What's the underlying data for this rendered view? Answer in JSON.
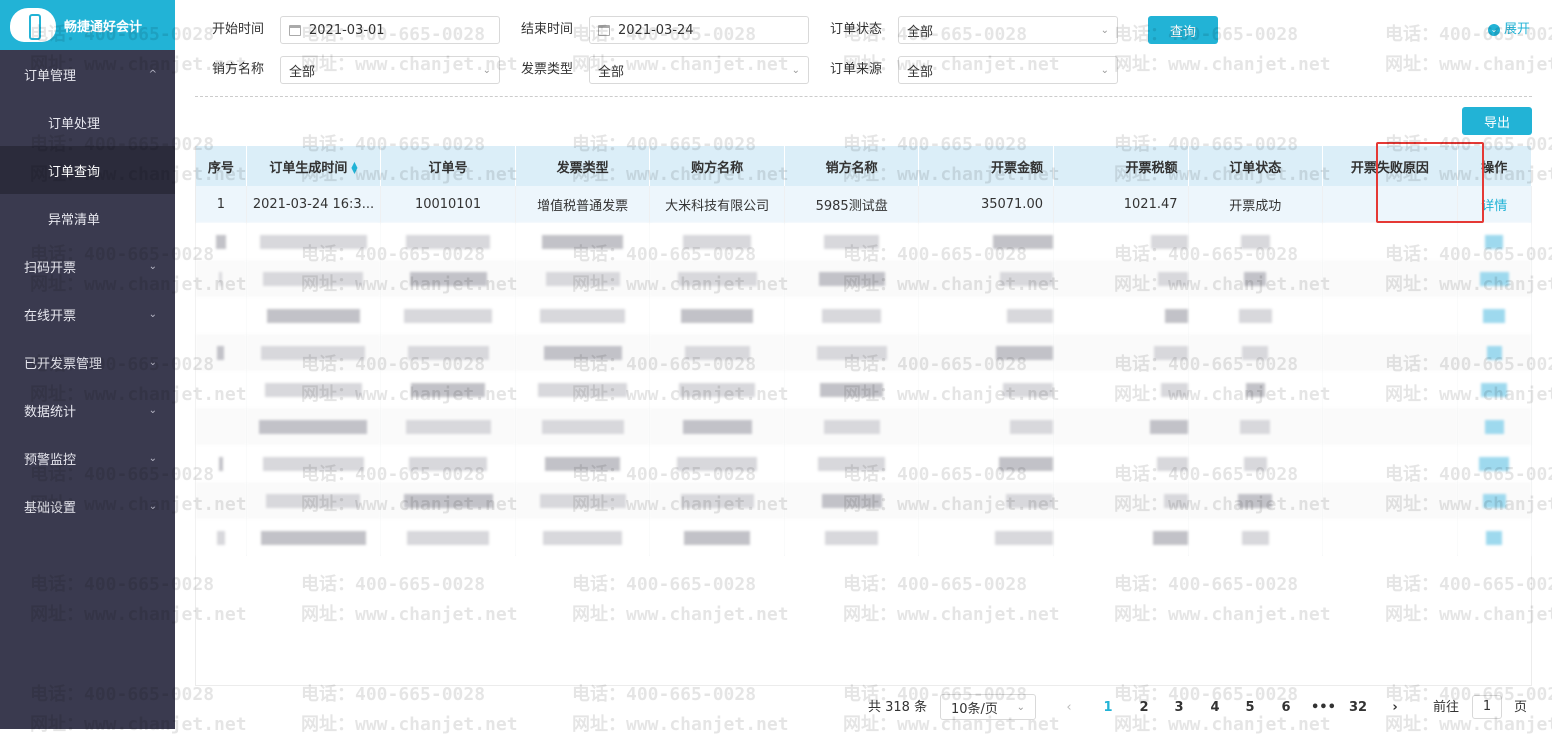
{
  "app": {
    "name": "畅捷通好会计"
  },
  "sidebar": {
    "groups": [
      {
        "label": "订单管理",
        "chevron": "^",
        "children": [
          "订单处理",
          "订单查询",
          "异常清单"
        ]
      },
      {
        "label": "扫码开票",
        "chevron": "⌄"
      },
      {
        "label": "在线开票",
        "chevron": "⌄"
      },
      {
        "label": "已开发票管理",
        "chevron": "⌄"
      },
      {
        "label": "数据统计",
        "chevron": "⌄"
      },
      {
        "label": "预警监控",
        "chevron": "⌄"
      },
      {
        "label": "基础设置",
        "chevron": "⌄"
      }
    ]
  },
  "filters": {
    "start_label": "开始时间",
    "start_value": "2021-03-01",
    "end_label": "结束时间",
    "end_value": "2021-03-24",
    "status_label": "订单状态",
    "status_value": "全部",
    "seller_label": "销方名称",
    "seller_value": "全部",
    "invoice_type_label": "发票类型",
    "invoice_type_value": "全部",
    "source_label": "订单来源",
    "source_value": "全部",
    "query_button": "查询",
    "expand_label": "展开",
    "export_button": "导出"
  },
  "table": {
    "headers": [
      "序号",
      "订单生成时间",
      "订单号",
      "发票类型",
      "购方名称",
      "销方名称",
      "开票金额",
      "开票税额",
      "订单状态",
      "开票失败原因",
      "操作"
    ],
    "row": [
      "1",
      "2021-03-24 16:3...",
      "10010101",
      "增值税普通发票",
      "大米科技有限公司",
      "5985测试盘",
      "35071.00",
      "1021.47",
      "开票成功",
      "",
      "详情"
    ]
  },
  "watermark": {
    "phone": "电话：400-665-0028",
    "site": "网址：www.chanjet.net"
  },
  "pagination": {
    "total": "共 318 条",
    "page_size": "10条/页",
    "pages": [
      "1",
      "2",
      "3",
      "4",
      "5",
      "6",
      "•••",
      "32"
    ],
    "goto_prefix": "前往",
    "goto_value": "1",
    "goto_suffix": "页"
  }
}
